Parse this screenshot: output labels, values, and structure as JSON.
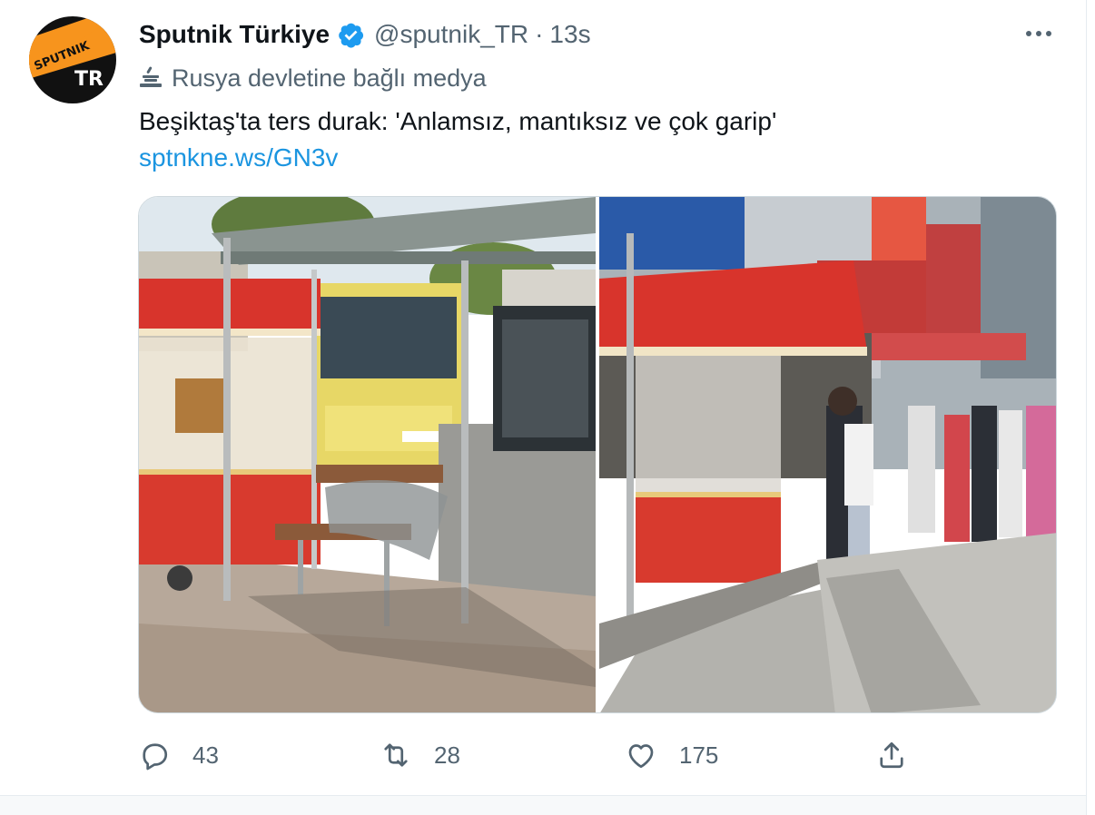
{
  "tweet": {
    "display_name": "Sputnik Türkiye",
    "handle": "@sputnik_TR",
    "separator": "·",
    "time": "13s",
    "label": "Rusya devletine bağlı medya",
    "text": "Beşiktaş'ta ters durak: 'Anlamsız, mantıksız ve çok garip'",
    "link": "sptnkne.ws/GN3v",
    "avatar": {
      "brand_text": "SPUTNIK",
      "region_text": "TR"
    }
  },
  "actions": {
    "reply_count": "43",
    "retweet_count": "28",
    "like_count": "175"
  },
  "colors": {
    "link": "#1b95e0",
    "secondary_text": "#536471",
    "verified": "#1d9bf0",
    "brand_orange": "#f7941d"
  },
  "icons": [
    "verified-badge-icon",
    "more-options-icon",
    "state-media-icon",
    "reply-icon",
    "retweet-icon",
    "like-icon",
    "share-icon"
  ]
}
